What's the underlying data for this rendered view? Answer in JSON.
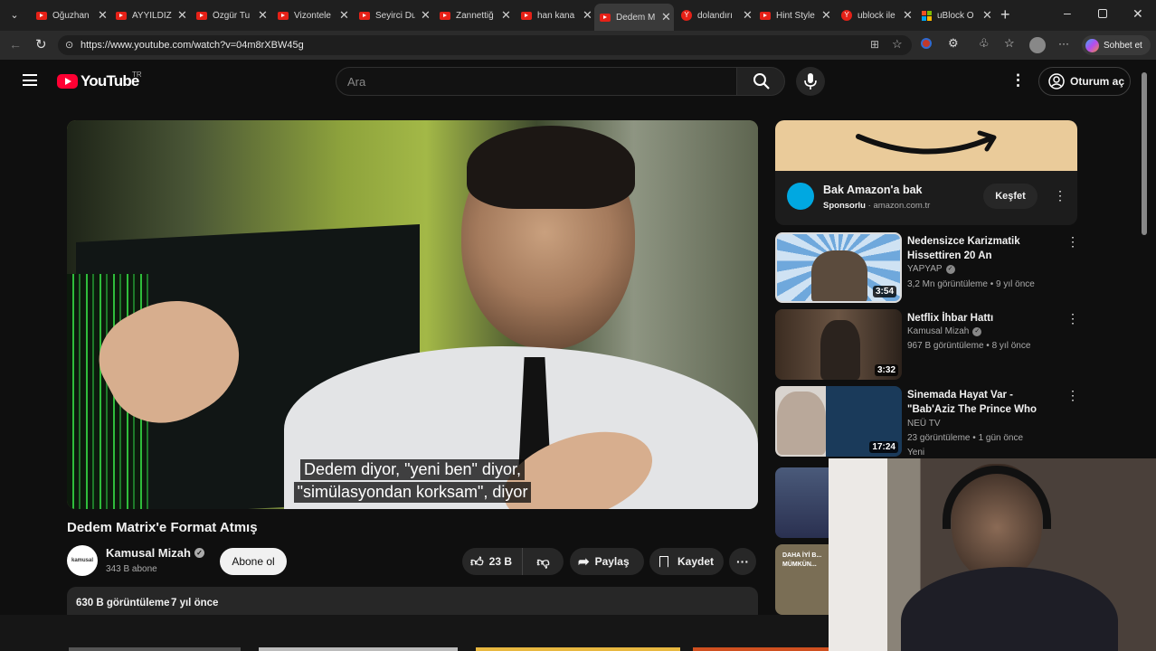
{
  "browser": {
    "tabs": [
      {
        "label": "Oğuzhan",
        "favicon": "youtube"
      },
      {
        "label": "AYYILDIZ",
        "favicon": "youtube"
      },
      {
        "label": "Özgür Tu",
        "favicon": "youtube"
      },
      {
        "label": "Vizontele",
        "favicon": "youtube"
      },
      {
        "label": "Seyirci Du",
        "favicon": "youtube"
      },
      {
        "label": "Zannettiğ",
        "favicon": "youtube"
      },
      {
        "label": "han kana",
        "favicon": "youtube"
      },
      {
        "label": "Dedem M",
        "favicon": "youtube",
        "active": true
      },
      {
        "label": "dolandırı",
        "favicon": "yandex"
      },
      {
        "label": "Hint Style",
        "favicon": "youtube"
      },
      {
        "label": "ublock ile",
        "favicon": "yandex"
      },
      {
        "label": "uBlock O",
        "favicon": "microsoft"
      }
    ],
    "url": "https://www.youtube.com/watch?v=04m8rXBW45g",
    "copilot_label": "Sohbet et"
  },
  "youtube": {
    "logo_text": "YouTube",
    "logo_region": "TR",
    "search_placeholder": "Ara",
    "signin_label": "Oturum aç",
    "subtitles": [
      "Dedem diyor, \"yeni ben\" diyor,",
      "\"simülasyondan korksam\", diyor"
    ],
    "video_title": "Dedem Matrix'e Format Atmış",
    "channel": {
      "name": "Kamusal Mizah",
      "subscribers": "343 B abone",
      "verified": true,
      "avatar_text": "kamusal"
    },
    "subscribe_label": "Abone ol",
    "actions": {
      "likes": "23 B",
      "share": "Paylaş",
      "save": "Kaydet"
    },
    "description": {
      "views": "630 B görüntüleme",
      "age": "7 yıl önce"
    },
    "ad": {
      "title": "Bak Amazon'a bak",
      "sponsored": "Sponsorlu",
      "domain": "amazon.com.tr",
      "cta": "Keşfet"
    },
    "recommendations": [
      {
        "title": "Nedensizce Karizmatik Hissettiren 20 An",
        "channel": "YAPYAP",
        "verified": true,
        "views": "3,2 Mn görüntüleme",
        "age": "9 yıl önce",
        "duration": "3:54"
      },
      {
        "title": "Netflix İhbar Hattı",
        "channel": "Kamusal Mizah",
        "verified": true,
        "views": "967 B görüntüleme",
        "age": "8 yıl önce",
        "duration": "3:32"
      },
      {
        "title": "Sinemada Hayat Var - \"Bab'Aziz The Prince Who Contemplated...",
        "channel": "NEÜ TV",
        "verified": false,
        "views": "23 görüntüleme",
        "age": "1 gün önce",
        "duration": "17:24",
        "badge": "Yeni"
      },
      {
        "title": "",
        "channel": "",
        "views": "",
        "age": "",
        "duration": ""
      },
      {
        "title": "",
        "channel": "",
        "views": "",
        "age": "",
        "duration": "",
        "thumb_text": "DAHA İYİ B... MÜMKÜN..."
      }
    ]
  },
  "colors": {
    "brand_red": "#ff0033",
    "bg": "#0f0f0f",
    "surface": "#272727",
    "amazon": "#eacb9a"
  }
}
